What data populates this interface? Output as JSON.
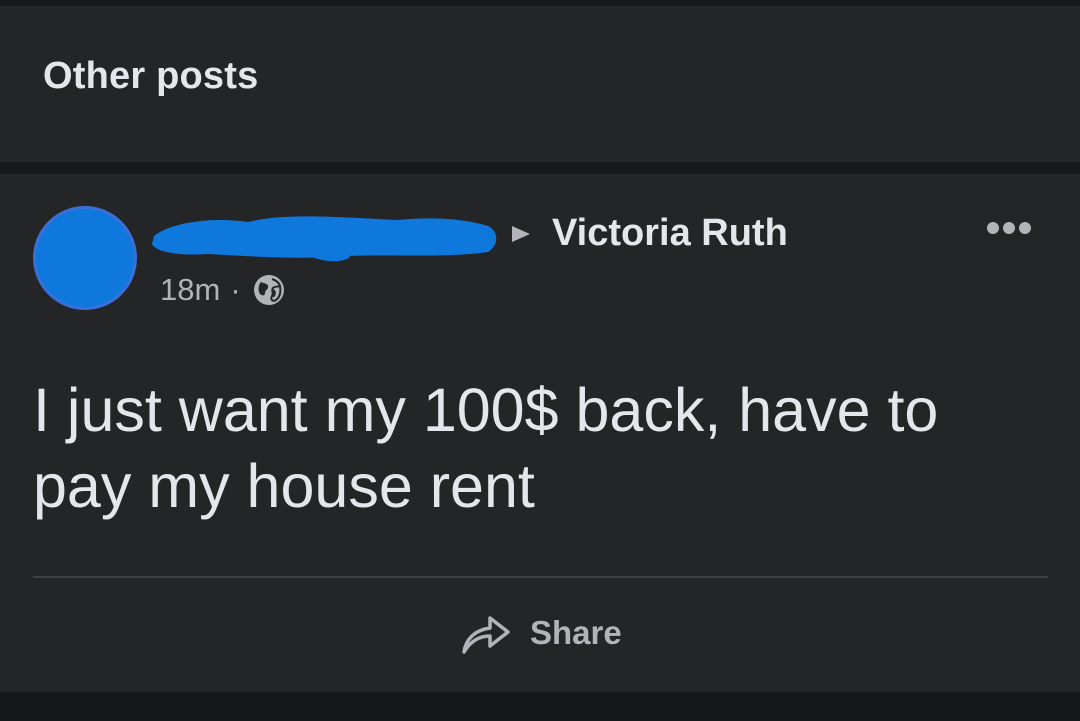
{
  "section": {
    "title": "Other posts"
  },
  "post": {
    "recipient": "Victoria Ruth",
    "time": "18m",
    "separator": "·",
    "privacy_icon": "globe-icon",
    "body": "I just want my 100$ back, have to pay my house rent",
    "actions": {
      "share_label": "Share",
      "share_icon": "share-arrow-icon",
      "more_icon": "more-dots-icon"
    }
  },
  "colors": {
    "background": "#242527",
    "separator": "#17181a",
    "text": "#e4e6eb",
    "secondary_text": "#b0b3b8",
    "redaction_blue": "#0f78dd"
  }
}
